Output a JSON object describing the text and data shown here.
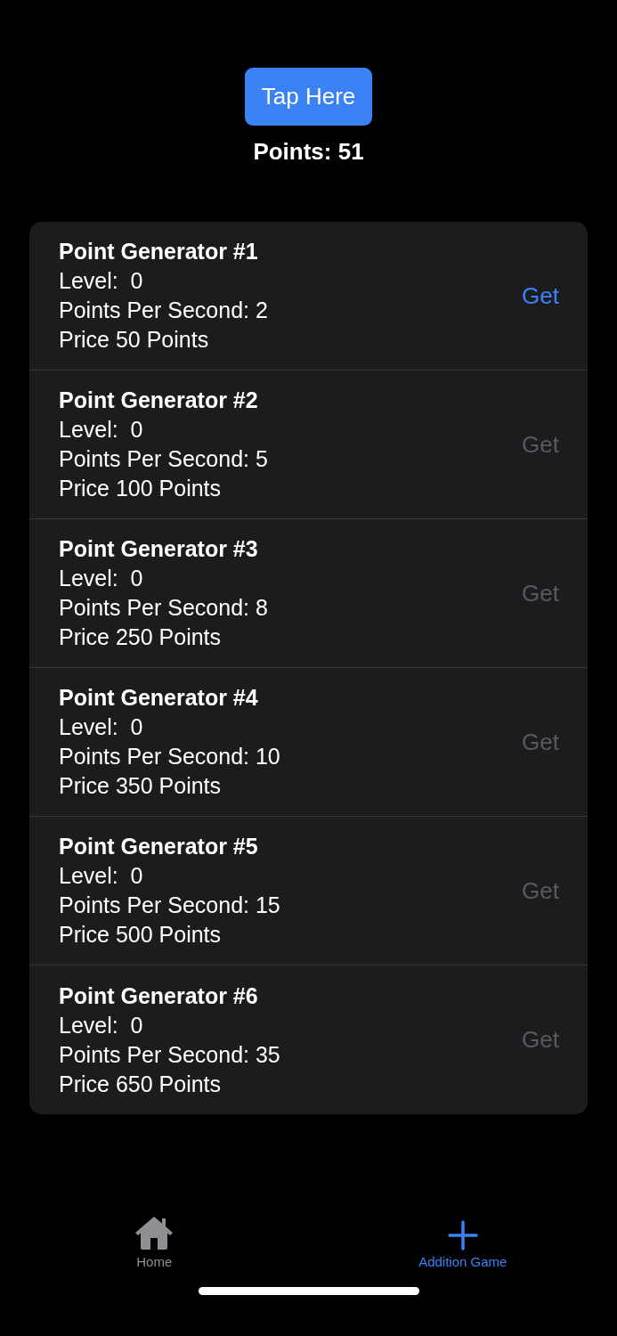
{
  "tap_button": {
    "label": "Tap Here"
  },
  "points": "Points: 51",
  "generators": [
    {
      "title": "Point Generator #1",
      "level": "Level:  0",
      "rate": "Points Per Second: 2",
      "price": "Price 50 Points",
      "action": "Get",
      "disabled": false
    },
    {
      "title": "Point Generator #2",
      "level": "Level:  0",
      "rate": "Points Per Second: 5",
      "price": "Price 100 Points",
      "action": "Get",
      "disabled": true
    },
    {
      "title": "Point Generator #3",
      "level": "Level:  0",
      "rate": "Points Per Second: 8",
      "price": "Price 250 Points",
      "action": "Get",
      "disabled": true
    },
    {
      "title": "Point Generator #4",
      "level": "Level:  0",
      "rate": "Points Per Second: 10",
      "price": "Price 350 Points",
      "action": "Get",
      "disabled": true
    },
    {
      "title": "Point Generator #5",
      "level": "Level:  0",
      "rate": "Points Per Second: 15",
      "price": "Price 500 Points",
      "action": "Get",
      "disabled": true
    },
    {
      "title": "Point Generator #6",
      "level": "Level:  0",
      "rate": "Points Per Second: 35",
      "price": "Price 650 Points",
      "action": "Get",
      "disabled": true
    }
  ],
  "tabs": [
    {
      "kind": "home",
      "label": "Home",
      "selected": false
    },
    {
      "kind": "plus",
      "label": "Addition Game",
      "selected": true
    }
  ]
}
